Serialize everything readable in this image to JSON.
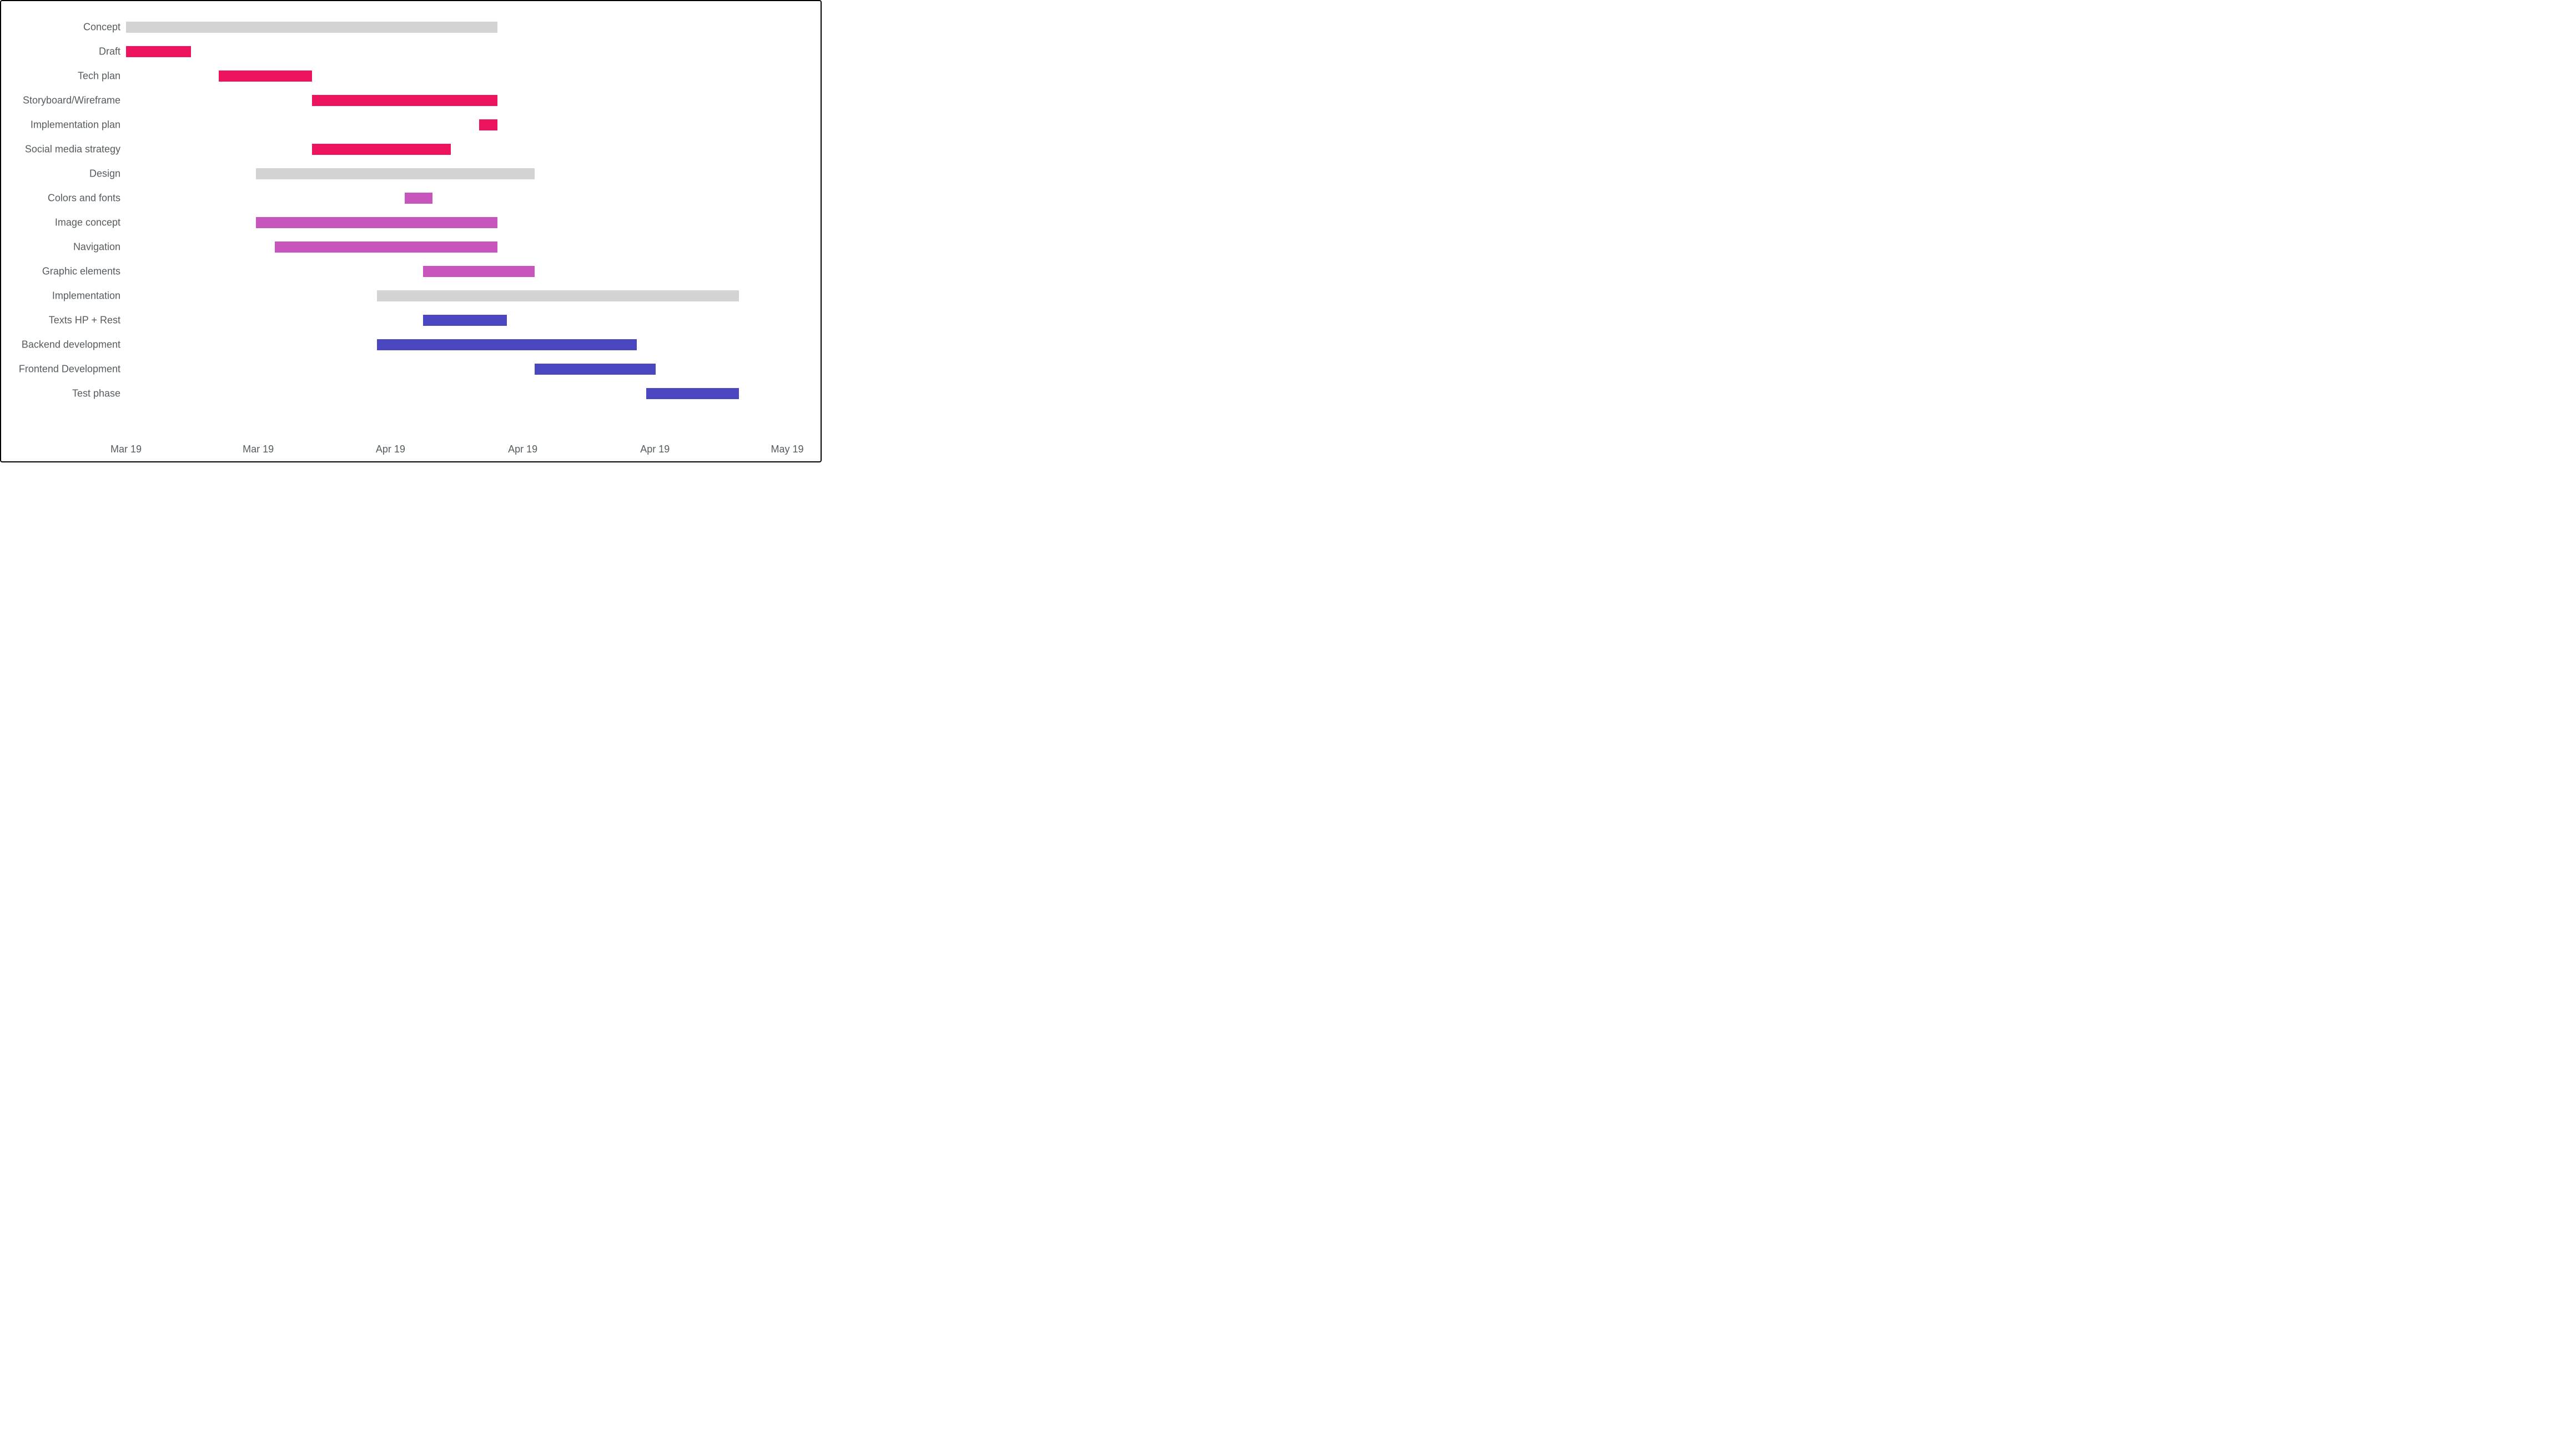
{
  "chart_data": {
    "type": "bar",
    "orientation": "horizontal-gantt",
    "title": "",
    "xlabel": "",
    "ylabel": "",
    "x_axis": {
      "ticks": [
        {
          "pos": 0.0,
          "label": "Mar 19"
        },
        {
          "pos": 0.2,
          "label": "Mar 19"
        },
        {
          "pos": 0.4,
          "label": "Apr 19"
        },
        {
          "pos": 0.6,
          "label": "Apr 19"
        },
        {
          "pos": 0.8,
          "label": "Apr 19"
        },
        {
          "pos": 1.0,
          "label": "May 19"
        }
      ],
      "range_days": [
        0,
        70
      ]
    },
    "colors": {
      "group": "#d3d3d3",
      "concept": "#ee135e",
      "design": "#c755bd",
      "impl": "#4a47c0"
    },
    "tasks": [
      {
        "label": "Concept",
        "start": 0,
        "end": 40,
        "color": "group"
      },
      {
        "label": "Draft",
        "start": 0,
        "end": 7,
        "color": "concept"
      },
      {
        "label": "Tech plan",
        "start": 10,
        "end": 20,
        "color": "concept"
      },
      {
        "label": "Storyboard/Wireframe",
        "start": 20,
        "end": 40,
        "color": "concept"
      },
      {
        "label": "Implementation plan",
        "start": 38,
        "end": 40,
        "color": "concept"
      },
      {
        "label": "Social media strategy",
        "start": 20,
        "end": 35,
        "color": "concept"
      },
      {
        "label": "Design",
        "start": 14,
        "end": 44,
        "color": "group"
      },
      {
        "label": "Colors and fonts",
        "start": 30,
        "end": 33,
        "color": "design"
      },
      {
        "label": "Image concept",
        "start": 14,
        "end": 40,
        "color": "design"
      },
      {
        "label": "Navigation",
        "start": 16,
        "end": 40,
        "color": "design"
      },
      {
        "label": "Graphic elements",
        "start": 32,
        "end": 44,
        "color": "design"
      },
      {
        "label": "Implementation",
        "start": 27,
        "end": 66,
        "color": "group"
      },
      {
        "label": "Texts HP + Rest",
        "start": 32,
        "end": 41,
        "color": "impl"
      },
      {
        "label": "Backend development",
        "start": 27,
        "end": 55,
        "color": "impl"
      },
      {
        "label": "Frontend Development",
        "start": 44,
        "end": 57,
        "color": "impl"
      },
      {
        "label": "Test phase",
        "start": 56,
        "end": 66,
        "color": "impl"
      }
    ]
  }
}
